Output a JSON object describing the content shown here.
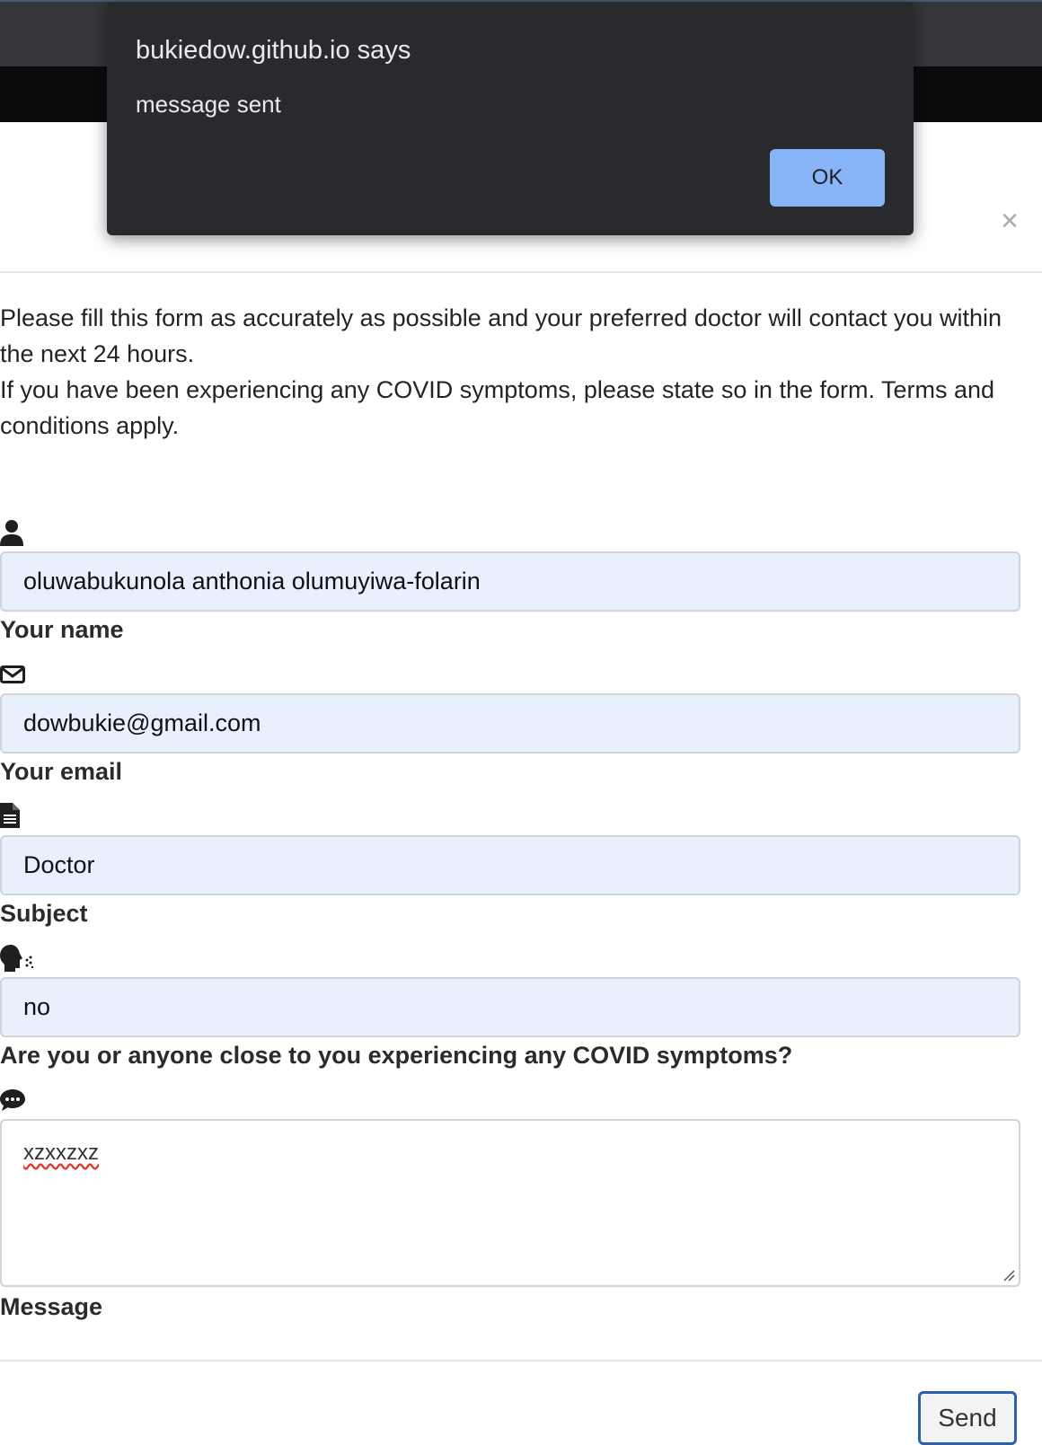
{
  "dialog": {
    "title": "bukiedow.github.io says",
    "message": "message sent",
    "ok_label": "OK"
  },
  "modal": {
    "close_glyph": "×",
    "intro": [
      "Please fill this form as accurately as possible and your preferred doctor will contact you within the next 24 hours.",
      "If you have been experiencing any COVID symptoms, please state so in the form. Terms and conditions apply."
    ]
  },
  "form": {
    "name": {
      "icon": "user-icon",
      "value": "oluwabukunola anthonia olumuyiwa-folarin",
      "label": "Your name"
    },
    "email": {
      "icon": "envelope-icon",
      "value": "dowbukie@gmail.com",
      "label": "Your email"
    },
    "subject": {
      "icon": "document-icon",
      "value": "Doctor",
      "label": "Subject"
    },
    "covid": {
      "icon": "head-side-cough-icon",
      "value": "no",
      "label": "Are you or anyone close to you experiencing any COVID symptoms?"
    },
    "message": {
      "icon": "comment-dots-icon",
      "value": "xzxxzxz",
      "label": "Message"
    },
    "send_label": "Send"
  },
  "colors": {
    "autofill_bg": "#e8f0fe",
    "dialog_bg": "#292a2d",
    "ok_button": "#8ab4f8",
    "send_border": "#2f5fa8"
  }
}
